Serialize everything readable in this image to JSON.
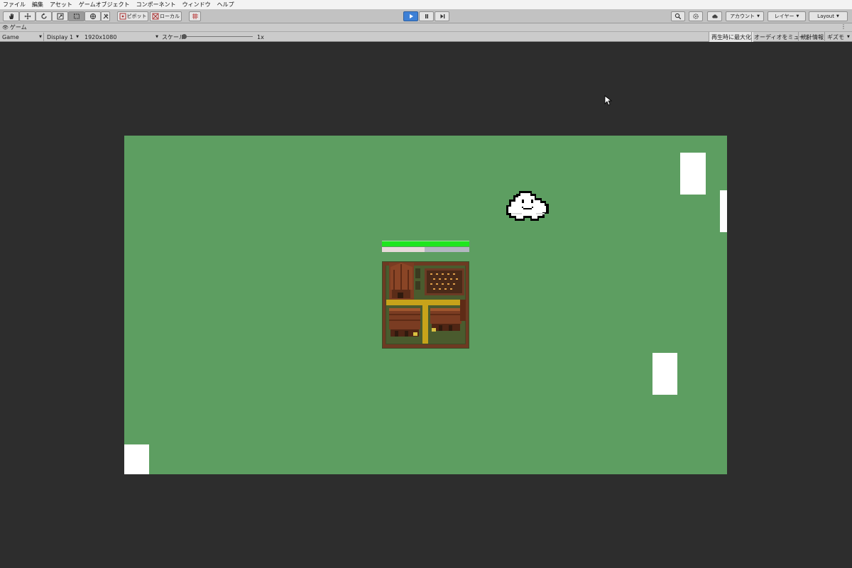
{
  "menu": [
    "ファイル",
    "編集",
    "アセット",
    "ゲームオブジェクト",
    "コンポーネント",
    "ウィンドウ",
    "ヘルプ"
  ],
  "toolbar": {
    "pivot_label": "ピボット",
    "local_label": "ローカル",
    "account_label": "アカウント",
    "layers_label": "レイヤー",
    "layout_label": "Layout",
    "tools": [
      "hand-tool-icon",
      "move-tool-icon",
      "rotate-tool-icon",
      "scale-tool-icon",
      "rect-tool-icon",
      "transform-tool-icon",
      "custom-tool-icon"
    ],
    "active_tool": "rect-tool-icon"
  },
  "panel": {
    "tab_label": "ゲーム",
    "view_mode": "Game",
    "display": "Display 1",
    "resolution": "1920x1080",
    "scale_label": "スケール",
    "scale_value": "1x",
    "scale_fraction": 0.0,
    "maximize_label": "再生時に最大化",
    "mute_label": "オーディオをミュート",
    "stats_label": "統計情報",
    "gizmos_label": "ギズモ"
  },
  "game": {
    "background_color": "#5d9e61",
    "player": {
      "health_fraction": 1.0,
      "experience_fraction": 0.49,
      "health_color": "#1ee61e",
      "experience_color": "#e7dada"
    },
    "sprites": [
      "cloud-enemy",
      "farm-building"
    ]
  },
  "colors": {
    "play_accent": "#3d80d6",
    "editor_background": "#2d2d2d"
  }
}
